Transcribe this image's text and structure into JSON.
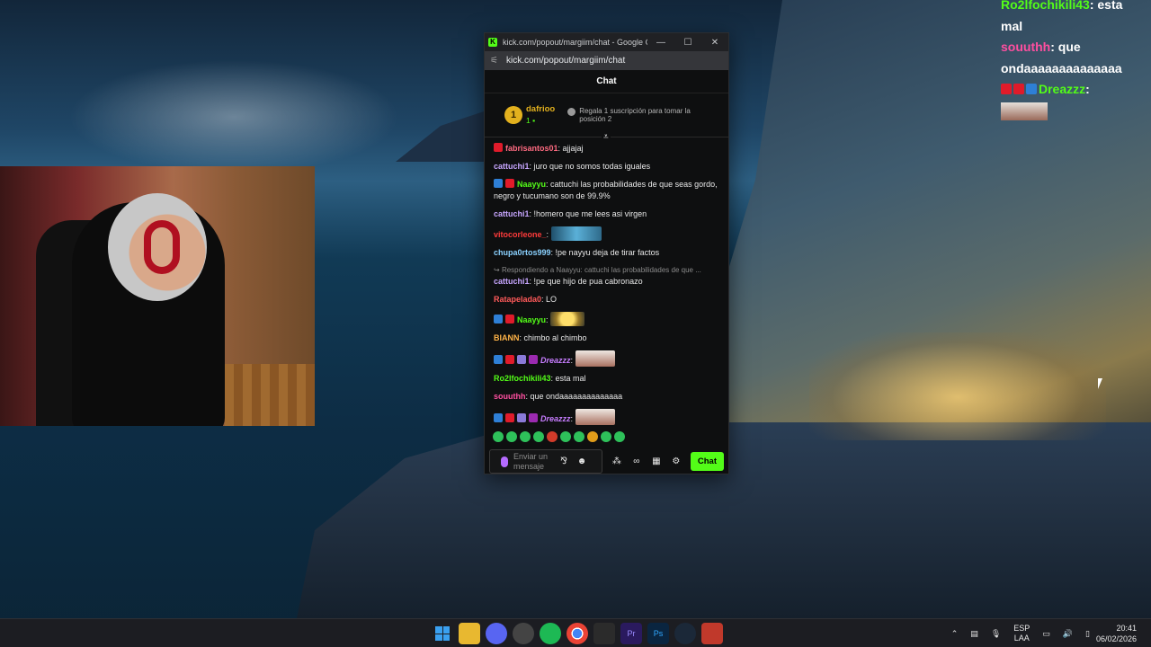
{
  "window": {
    "title": "kick.com/popout/margiim/chat - Google Chr...",
    "url": "kick.com/popout/margiim/chat",
    "minimize": "—",
    "maximize": "☐",
    "close": "✕"
  },
  "chat": {
    "header": "Chat",
    "pinned": {
      "rank": "1",
      "username": "dafrioo",
      "subs": "1 ▪",
      "cta": "Regala 1 suscripción para tomar la posición 2"
    },
    "messages": [
      {
        "user": "fabrisantos01",
        "color": "#ff6b81",
        "text": "ajjajaj"
      },
      {
        "user": "cattuchi1",
        "color": "#c7a6ff",
        "text": "juro que no somos todas iguales"
      },
      {
        "user": "Naayyu",
        "color": "#53fc18",
        "text": "cattuchi las probabilidades de que seas gordo, negro y tucumano son de 99.9%"
      },
      {
        "user": "cattuchi1",
        "color": "#c7a6ff",
        "text": "!homero que me lees asi virgen"
      },
      {
        "user": "vitocorleone_",
        "color": "#ff3b3b",
        "text": ""
      },
      {
        "user": "chupa0rtos999",
        "color": "#8ad1ff",
        "text": "!pe nayyu deja de tirar factos"
      },
      {
        "user": "cattuchi1",
        "color": "#c7a6ff",
        "text": "!pe que hijo de pua cabronazo",
        "reply": "Respondiendo a Naayyu: cattuchi las probabilidades de que ..."
      },
      {
        "user": "Ratapelada0",
        "color": "#ff5a5a",
        "text": "LO"
      },
      {
        "user": "Naayyu",
        "color": "#53fc18",
        "text": ""
      },
      {
        "user": "BIANN",
        "color": "#ffb347",
        "text": "chimbo al chimbo"
      },
      {
        "user": "Dreazzz",
        "color": "#c77dff",
        "text": ""
      },
      {
        "user": "Ro2lfochikili43",
        "color": "#53fc18",
        "text": "esta mal"
      },
      {
        "user": "souuthh",
        "color": "#ff4fa0",
        "text": "que ondaaaaaaaaaaaaaa"
      },
      {
        "user": "Dreazzz",
        "color": "#c77dff",
        "text": ""
      }
    ],
    "input_placeholder": "Enviar un mensaje",
    "send_label": "Chat"
  },
  "overlay": {
    "lines": [
      {
        "user": "Ro2lfochikili43",
        "text": "esta"
      },
      {
        "user": "",
        "text": "mal"
      },
      {
        "user": "souuthh",
        "text": "que"
      },
      {
        "user": "",
        "text": "ondaaaaaaaaaaaaaa"
      },
      {
        "user": "Dreazzz",
        "text": ""
      }
    ]
  },
  "taskbar": {
    "lang": "ESP",
    "lang_sub": "LAA",
    "time": "20:41",
    "date": "06/02/2026",
    "apps": [
      "windows-start",
      "file-explorer",
      "discord",
      "obs",
      "spotify",
      "chrome",
      "epic",
      "premiere",
      "photoshop",
      "steam",
      "twitch-app"
    ]
  },
  "colors": {
    "kick_green": "#53fc18",
    "window_bg": "#0e0f10",
    "taskbar": "#1c1d22"
  }
}
